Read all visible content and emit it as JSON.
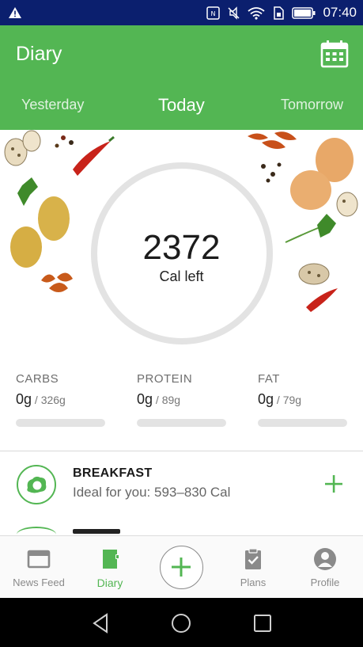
{
  "status_bar": {
    "time": "07:40",
    "icons": [
      "warning-icon",
      "nfc-icon",
      "mute-icon",
      "wifi-icon",
      "sim-icon",
      "battery-icon"
    ]
  },
  "header": {
    "title": "Diary",
    "calendar_icon": "calendar-icon",
    "days": {
      "yesterday": "Yesterday",
      "today": "Today",
      "tomorrow": "Tomorrow"
    }
  },
  "summary": {
    "calories_left": "2372",
    "calories_label": "Cal left",
    "ring_progress": 0
  },
  "macros": [
    {
      "label": "CARBS",
      "value": "0g",
      "goal": " / 326g",
      "progress": 0
    },
    {
      "label": "PROTEIN",
      "value": "0g",
      "goal": " / 89g",
      "progress": 0
    },
    {
      "label": "FAT",
      "value": "0g",
      "goal": " / 79g",
      "progress": 0
    }
  ],
  "meals": [
    {
      "title": "BREAKFAST",
      "subtitle": "Ideal for you: 593–830 Cal",
      "icon": "egg-icon",
      "add_icon": "plus-icon"
    }
  ],
  "bottom_nav": {
    "items": [
      {
        "label": "News Feed",
        "icon": "news-feed-icon"
      },
      {
        "label": "Diary",
        "icon": "diary-icon"
      },
      {
        "label": "Plans",
        "icon": "plans-icon"
      },
      {
        "label": "Profile",
        "icon": "profile-icon"
      }
    ],
    "fab_icon": "plus-icon"
  },
  "colors": {
    "brand_green": "#53b653",
    "status_bar": "#0b1f6e",
    "ring_track": "#e3e3e3",
    "inactive": "#8a8a8a"
  }
}
